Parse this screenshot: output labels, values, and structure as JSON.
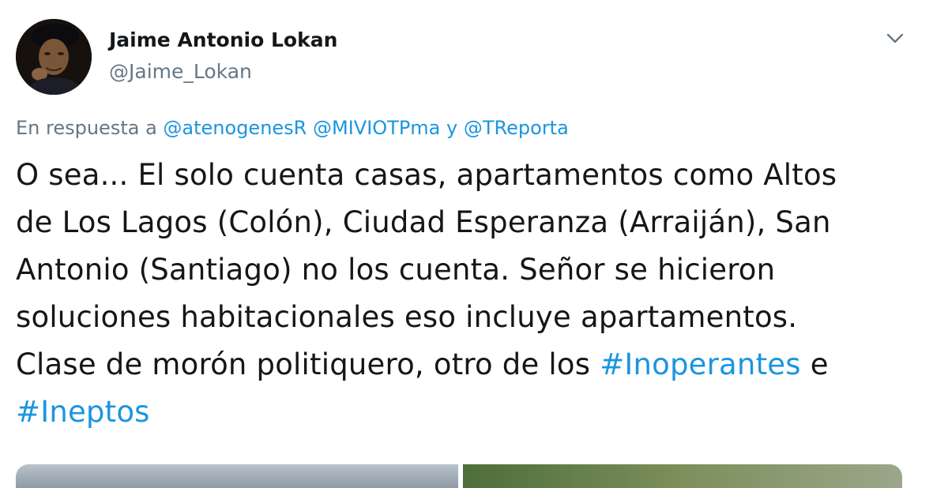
{
  "author": {
    "display_name": "Jaime Antonio Lokan",
    "handle": "@Jaime_Lokan",
    "avatar_icon": "user-avatar-photo"
  },
  "reply": {
    "prefix": "En respuesta a",
    "mentions": [
      "@atenogenesR",
      "@MIVIOTPma",
      "@TReporta"
    ],
    "conjunction": "y"
  },
  "text": {
    "line1": "O sea... El solo cuenta casas, apartamentos como Altos",
    "line2": "de Los Lagos (Colón), Ciudad Esperanza (Arraiján), San",
    "line3": "Antonio (Santiago) no los cuenta. Señor se hicieron",
    "line4": "soluciones habitacionales eso incluye apartamentos.",
    "line5_start": "Clase de morón politiquero, otro de los",
    "hashtag1": "#Inoperantes",
    "line5_end": "e",
    "hashtag2": "#Ineptos"
  },
  "icons": {
    "more": "chevron-down-icon"
  },
  "colors": {
    "link": "#1b95e0",
    "secondary_text": "#657786",
    "primary_text": "#14171a"
  }
}
